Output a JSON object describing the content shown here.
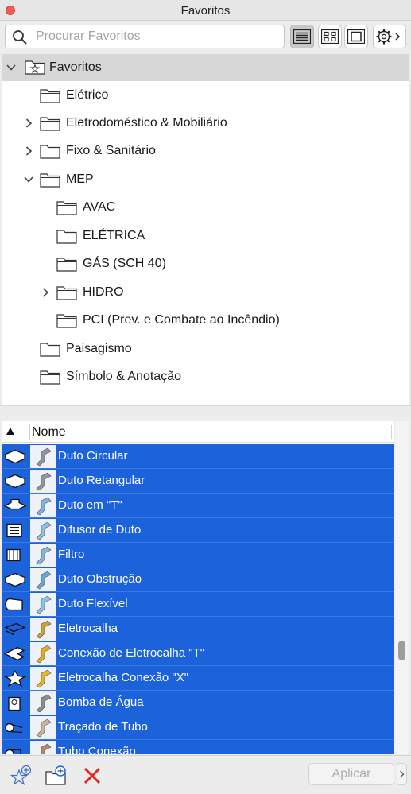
{
  "window": {
    "title": "Favoritos"
  },
  "search": {
    "placeholder": "Procurar Favoritos",
    "value": ""
  },
  "toolbar": {
    "view_buttons": [
      "list-view",
      "grid-view",
      "preview-view"
    ],
    "active_view": "list-view",
    "options_menu": "gear-icon"
  },
  "tree": {
    "root": {
      "label": "Favoritos",
      "expanded": true
    },
    "items": [
      {
        "label": "Elétrico",
        "expandable": false
      },
      {
        "label": "Eletrodoméstico & Mobiliário",
        "expandable": true,
        "expanded": false
      },
      {
        "label": "Fixo & Sanitário",
        "expandable": true,
        "expanded": false
      },
      {
        "label": "MEP",
        "expandable": true,
        "expanded": true,
        "children": [
          {
            "label": "AVAC",
            "expandable": false
          },
          {
            "label": "ELÉTRICA",
            "expandable": false
          },
          {
            "label": "GÁS (SCH 40)",
            "expandable": false
          },
          {
            "label": "HIDRO",
            "expandable": true,
            "expanded": false
          },
          {
            "label": "PCI (Prev. e Combate ao Incêndio)",
            "expandable": false
          }
        ]
      },
      {
        "label": "Paisagismo",
        "expandable": false
      },
      {
        "label": "Símbolo & Anotação",
        "expandable": false
      }
    ]
  },
  "list": {
    "column": "Nome",
    "sort": "ascending",
    "selection_color": "#1c62da",
    "items": [
      {
        "label": "Duto Circular",
        "icon": "duct-icon"
      },
      {
        "label": "Duto Retangular",
        "icon": "duct-icon"
      },
      {
        "label": "Duto em \"T\"",
        "icon": "duct-tee-icon"
      },
      {
        "label": "Difusor de Duto",
        "icon": "diffuser-icon"
      },
      {
        "label": "Filtro",
        "icon": "filter-icon"
      },
      {
        "label": "Duto Obstrução",
        "icon": "duct-obstruction-icon"
      },
      {
        "label": "Duto Flexível",
        "icon": "flexible-duct-icon"
      },
      {
        "label": "Eletrocalha",
        "icon": "cable-tray-icon"
      },
      {
        "label": "Conexão de Eletrocalha \"T\"",
        "icon": "cable-tray-tee-icon"
      },
      {
        "label": "Eletrocalha Conexão \"X\"",
        "icon": "cable-tray-cross-icon"
      },
      {
        "label": "Bomba de Água",
        "icon": "pump-icon"
      },
      {
        "label": "Traçado de Tubo",
        "icon": "pipe-route-icon"
      },
      {
        "label": "Tubo Conexão",
        "icon": "pipe-fitting-icon"
      }
    ]
  },
  "footer": {
    "apply_label": "Aplicar",
    "buttons": [
      "add-favorite-icon",
      "new-folder-icon",
      "delete-icon"
    ]
  },
  "colors": {
    "delete": "#e0261f",
    "close": "#ec5f57",
    "tree_header": "#d7d7d7"
  }
}
